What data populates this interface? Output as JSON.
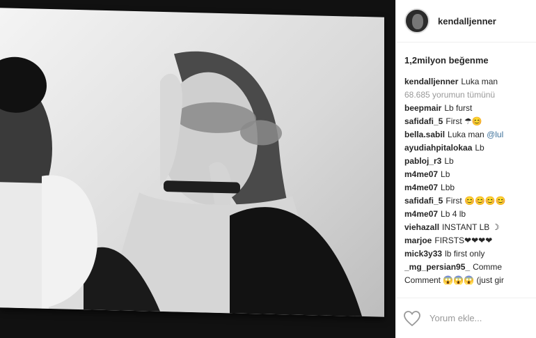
{
  "header": {
    "username": "kendalljenner"
  },
  "likes_text": "1,2milyon beğenme",
  "caption": {
    "user": "kendalljenner",
    "text": "Luka man"
  },
  "view_all": "68.685 yorumun tümünü",
  "comments": [
    {
      "user": "beepmair",
      "text": "Lb furst"
    },
    {
      "user": "safidafi_5",
      "text": "First ☂😊"
    },
    {
      "user": "bella.sabil",
      "text": "Luka man",
      "mention": "@lul"
    },
    {
      "user": "ayudiahpitalokaa",
      "text": "Lb"
    },
    {
      "user": "pabloj_r3",
      "text": "Lb"
    },
    {
      "user": "m4me07",
      "text": "Lb"
    },
    {
      "user": "m4me07",
      "text": "Lbb"
    },
    {
      "user": "safidafi_5",
      "text": "First 😊😊😊😊"
    },
    {
      "user": "m4me07",
      "text": "Lb 4 lb"
    },
    {
      "user": "viehazall",
      "text": "INSTANT LB ☽"
    },
    {
      "user": "marjoe",
      "text": "FIRSTS❤❤❤❤"
    },
    {
      "user": "mick3y33",
      "text": "lb first only"
    },
    {
      "user": "_mg_persian95_",
      "text": "Comme"
    },
    {
      "user": "",
      "text": "Comment 😱😱😱 (just gir"
    }
  ],
  "footer": {
    "add_comment_placeholder": "Yorum ekle...",
    "icon": "heart-icon"
  }
}
